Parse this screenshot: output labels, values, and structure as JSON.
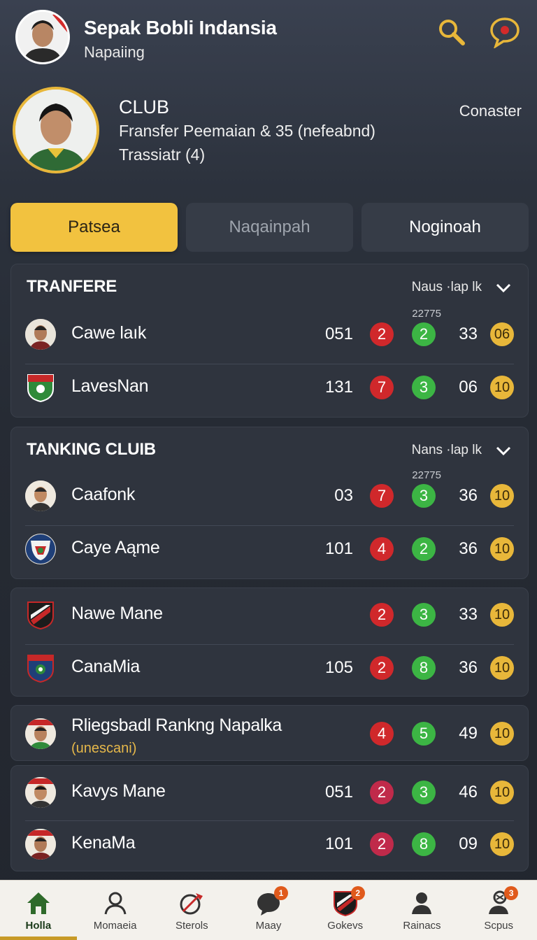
{
  "header": {
    "title": "Sepak Bobli Indansia",
    "subtitle": "Napaiing",
    "search_icon": "search-icon",
    "chat_icon": "chat-icon",
    "accent": "#e8b73a"
  },
  "profile": {
    "club_label": "CLUB",
    "line1": "Fransfer Peemaian & 35 (nefeabnd)",
    "line2": "Trassiatr  (4)",
    "right_label": "Conaster"
  },
  "tabs": [
    {
      "label": "Patsea",
      "active": true
    },
    {
      "label": "Naqainpah",
      "active": false
    },
    {
      "label": "Noginoah",
      "active": false
    }
  ],
  "sections": [
    {
      "title": "TRANFERE",
      "sort_label": "Naus ·lap lk",
      "note": "22775",
      "rows": [
        {
          "name": "Cawe laık",
          "num": "051",
          "red": "2",
          "green": "2",
          "score": "33",
          "gold": "06"
        },
        {
          "name": "LavesNan",
          "num": "131",
          "red": "7",
          "green": "3",
          "score": "06",
          "gold": "10"
        }
      ]
    },
    {
      "title": "TANKING CLUIB",
      "sort_label": "Nans ·lap lk",
      "note": "22775",
      "rows": [
        {
          "name": "Caafonk",
          "num": "03",
          "red": "7",
          "green": "3",
          "score": "36",
          "gold": "10"
        },
        {
          "name": "Caye Aąme",
          "num": "101",
          "red": "4",
          "green": "2",
          "score": "36",
          "gold": "10"
        }
      ]
    },
    {
      "rows": [
        {
          "name": "Nawe Mane",
          "num": "",
          "red": "2",
          "green": "3",
          "score": "33",
          "gold": "10"
        },
        {
          "name": "CanaMia",
          "num": "105",
          "red": "2",
          "green": "8",
          "score": "36",
          "gold": "10"
        }
      ]
    },
    {
      "rows": [
        {
          "name": "Rliegsbadl Rankng Napalka",
          "sub": "(unescani)",
          "num": "",
          "red": "4",
          "green": "5",
          "score": "49",
          "gold": "10"
        }
      ]
    },
    {
      "rows": [
        {
          "name": "Kavys Mane",
          "num": "051",
          "red": "2",
          "green": "3",
          "score": "46",
          "gold": "10"
        },
        {
          "name": "KenaMa",
          "num": "101",
          "red": "2",
          "green": "8",
          "score": "09",
          "gold": "10"
        }
      ]
    }
  ],
  "bottom_nav": [
    {
      "label": "Holla",
      "icon": "home-icon",
      "badge": "",
      "active": true
    },
    {
      "label": "Momaeia",
      "icon": "user-icon",
      "badge": "",
      "active": false
    },
    {
      "label": "Sterols",
      "icon": "whistle-icon",
      "badge": "",
      "active": false
    },
    {
      "label": "Maay",
      "icon": "chat-bubble-icon",
      "badge": "1",
      "active": false
    },
    {
      "label": "Gokevs",
      "icon": "club-shield-icon",
      "badge": "2",
      "active": false
    },
    {
      "label": "Rainacs",
      "icon": "person-icon",
      "badge": "",
      "active": false
    },
    {
      "label": "Scpus",
      "icon": "ball-player-icon",
      "badge": "3",
      "active": false
    }
  ]
}
